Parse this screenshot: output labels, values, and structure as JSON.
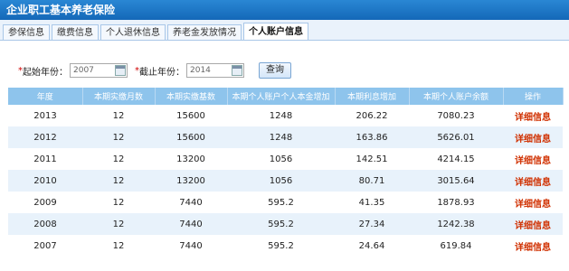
{
  "window": {
    "title": "企业职工基本养老保险"
  },
  "tabs": [
    {
      "label": "参保信息"
    },
    {
      "label": "缴费信息"
    },
    {
      "label": "个人退休信息"
    },
    {
      "label": "养老金发放情况"
    },
    {
      "label": "个人账户信息",
      "active": true
    }
  ],
  "search": {
    "start_label": "起始年份：",
    "start_value": "2007",
    "end_label": "截止年份：",
    "end_value": "2014",
    "required_mark": "*",
    "query_label": "查询"
  },
  "table": {
    "headers": [
      "年度",
      "本期实缴月数",
      "本期实缴基数",
      "本期个人账户个人本金增加",
      "本期利息增加",
      "本期个人账户余额",
      "操作"
    ],
    "rows": [
      [
        "2013",
        "12",
        "15600",
        "1248",
        "206.22",
        "7080.23",
        "详细信息"
      ],
      [
        "2012",
        "12",
        "15600",
        "1248",
        "163.86",
        "5626.01",
        "详细信息"
      ],
      [
        "2011",
        "12",
        "13200",
        "1056",
        "142.51",
        "4214.15",
        "详细信息"
      ],
      [
        "2010",
        "12",
        "13200",
        "1056",
        "80.71",
        "3015.64",
        "详细信息"
      ],
      [
        "2009",
        "12",
        "7440",
        "595.2",
        "41.35",
        "1878.93",
        "详细信息"
      ],
      [
        "2008",
        "12",
        "7440",
        "595.2",
        "27.34",
        "1242.38",
        "详细信息"
      ],
      [
        "2007",
        "12",
        "7440",
        "595.2",
        "24.64",
        "619.84",
        "详细信息"
      ]
    ]
  },
  "colors": {
    "header_bg": "#8ec4ec",
    "link": "#d03000",
    "title_bg": "#1a75c4"
  }
}
